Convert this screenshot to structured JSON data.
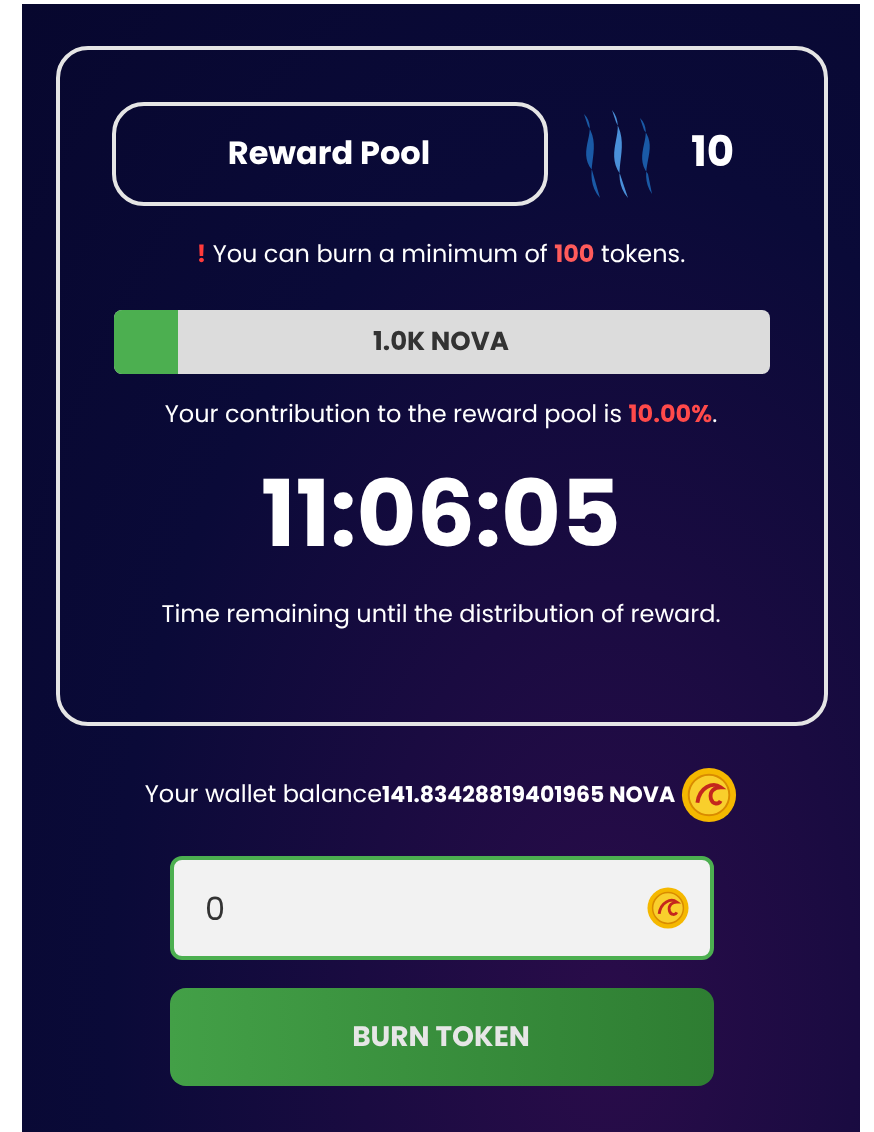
{
  "pool": {
    "title": "Reward Pool",
    "steem_count": "10",
    "warning": {
      "mark": "!",
      "before": "You can burn a minimum of",
      "amount": "100",
      "after": "tokens."
    },
    "progress": {
      "level": 0.1,
      "label": "1.0K NOVA"
    },
    "contribution": {
      "before": "Your contribution to the reward pool is",
      "value": "10.00%",
      "after": "."
    },
    "timer": "11:06:05",
    "timer_caption": "Time remaining until the distribution of reward."
  },
  "wallet": {
    "label": "Your wallet balance",
    "amount": "141.83428819401965 NOVA"
  },
  "burn_input": {
    "value": "0"
  },
  "burn_button": "BURN TOKEN"
}
